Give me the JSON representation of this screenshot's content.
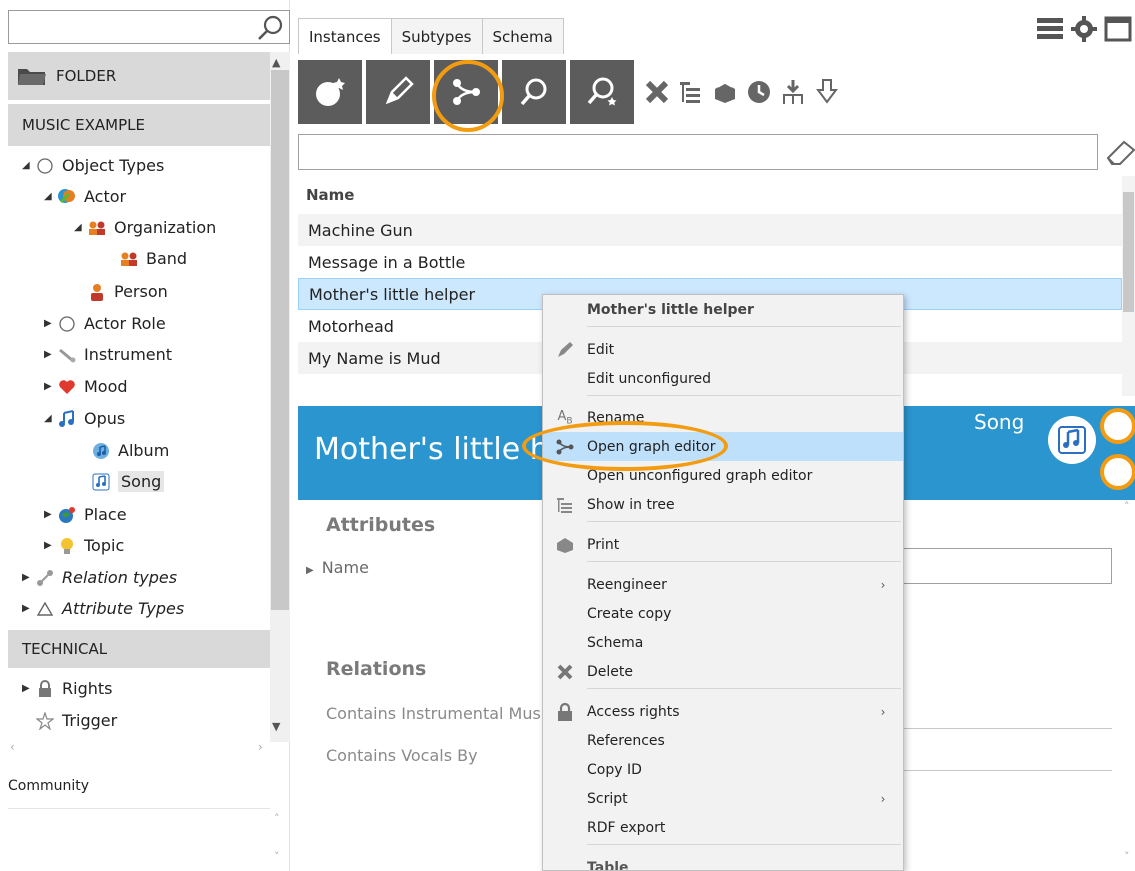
{
  "left": {
    "search_placeholder": "",
    "folder_label": "FOLDER",
    "music_label": "MUSIC EXAMPLE",
    "tree": [
      {
        "label": "Object Types",
        "italic": false
      },
      {
        "label": "Actor",
        "italic": false
      },
      {
        "label": "Organization",
        "italic": false
      },
      {
        "label": "Band",
        "italic": false
      },
      {
        "label": "Person",
        "italic": false
      },
      {
        "label": "Actor Role",
        "italic": false
      },
      {
        "label": "Instrument",
        "italic": false
      },
      {
        "label": "Mood",
        "italic": false
      },
      {
        "label": "Opus",
        "italic": false
      },
      {
        "label": "Album",
        "italic": false
      },
      {
        "label": "Song",
        "italic": false
      },
      {
        "label": "Place",
        "italic": false
      },
      {
        "label": "Topic",
        "italic": false
      },
      {
        "label": "Relation types",
        "italic": true
      },
      {
        "label": "Attribute Types",
        "italic": true
      }
    ],
    "technical_label": "TECHNICAL",
    "technical_tree": [
      {
        "label": "Rights"
      },
      {
        "label": "Trigger"
      }
    ],
    "community_label": "Community"
  },
  "tabs": [
    {
      "label": "Instances",
      "active": true
    },
    {
      "label": "Subtypes",
      "active": false
    },
    {
      "label": "Schema",
      "active": false
    }
  ],
  "list": {
    "header": "Name",
    "rows": [
      "Machine Gun",
      "Message in a Bottle",
      "Mother's little helper",
      "Motorhead",
      "My Name is Mud"
    ],
    "selected_index": 2
  },
  "banner": {
    "title": "Mother's little helper",
    "type": "Song"
  },
  "details": {
    "attributes_title": "Attributes",
    "name_label": "Name",
    "relations_title": "Relations",
    "relation_1": "Contains Instrumental Music By",
    "relation_2": "Contains Vocals By"
  },
  "context_menu": {
    "header": "Mother's little helper",
    "items": {
      "edit": "Edit",
      "edit_unconfigured": "Edit unconfigured",
      "rename": "Rename",
      "open_graph_editor": "Open graph editor",
      "open_unconfigured_graph_editor": "Open unconfigured graph editor",
      "show_in_tree": "Show in tree",
      "print": "Print",
      "reengineer": "Reengineer",
      "create_copy": "Create copy",
      "schema": "Schema",
      "delete": "Delete",
      "access_rights": "Access rights",
      "references": "References",
      "copy_id": "Copy ID",
      "script": "Script",
      "rdf_export": "RDF export",
      "table": "Table"
    }
  },
  "colors": {
    "accent_blue": "#2b95d0",
    "highlight_orange": "#f39c12",
    "selection": "#cce8ff",
    "toolbar_button": "#5c5c5c"
  }
}
